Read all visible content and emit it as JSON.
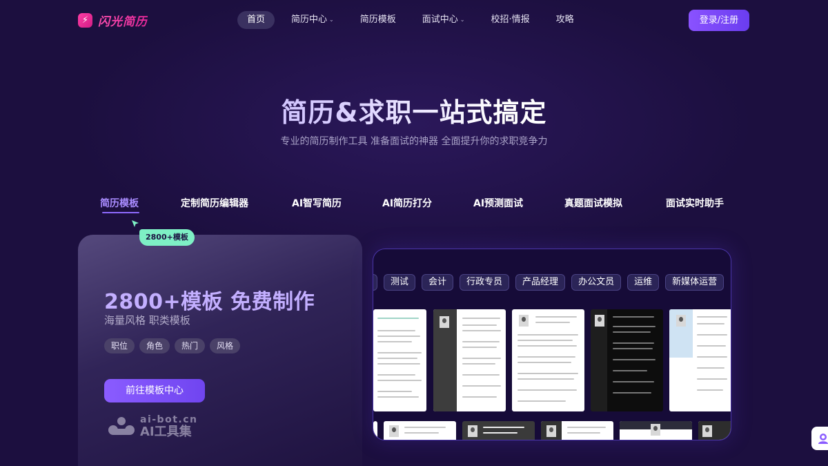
{
  "brand": {
    "name": "闪光简历",
    "logo_icon": "lightning-icon",
    "accent": "#e8289b"
  },
  "nav": {
    "items": [
      {
        "label": "首页",
        "dropdown": false,
        "active": true
      },
      {
        "label": "简历中心",
        "dropdown": true,
        "active": false
      },
      {
        "label": "简历模板",
        "dropdown": false,
        "active": false
      },
      {
        "label": "面试中心",
        "dropdown": true,
        "active": false
      },
      {
        "label": "校招·情报",
        "dropdown": false,
        "active": false
      },
      {
        "label": "攻略",
        "dropdown": false,
        "active": false
      }
    ],
    "login_label": "登录/注册"
  },
  "hero": {
    "title": "简历&求职一站式搞定",
    "subtitle": "专业的简历制作工具 准备面试的神器 全面提升你的求职竞争力"
  },
  "tabs": {
    "items": [
      "简历模板",
      "定制简历编辑器",
      "AI智写简历",
      "AI简历打分",
      "AI预测面试",
      "真题面试模拟",
      "面试实时助手"
    ],
    "active_index": 0
  },
  "badge": {
    "label": "2800+模板"
  },
  "feature_card": {
    "title": "2800+模板 免费制作",
    "subtitle": "海量风格 职类模板",
    "tags": [
      "职位",
      "角色",
      "热门",
      "风格"
    ],
    "cta_label": "前往模板中心"
  },
  "watermark": {
    "url": "ai-bot.cn",
    "name": "AI工具集"
  },
  "template_preview": {
    "categories": [
      "测试",
      "会计",
      "行政专员",
      "产品经理",
      "办公文员",
      "运维",
      "新媒体运营"
    ]
  },
  "help_float": {
    "icon": "support-avatar-icon"
  },
  "colors": {
    "background": "#1c0f3f",
    "primary": "#7a4df6",
    "active_tab": "#a98cff",
    "badge": "#7ef0c5"
  }
}
